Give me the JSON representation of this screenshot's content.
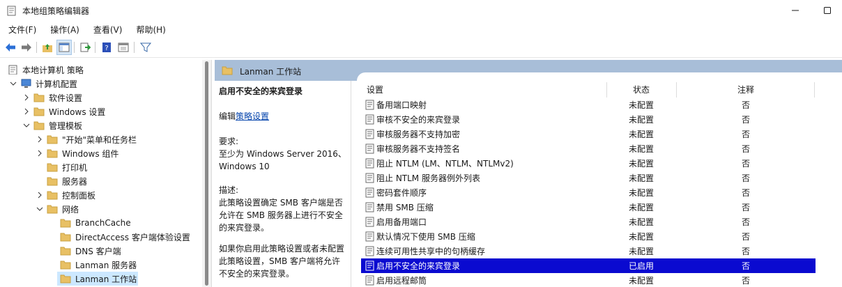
{
  "window": {
    "title": "本地组策略编辑器"
  },
  "menu": [
    "文件(F)",
    "操作(A)",
    "查看(V)",
    "帮助(H)"
  ],
  "toolbar": {
    "icons": [
      "back-icon",
      "forward-icon",
      "up-folder-icon",
      "show-hide-tree-icon",
      "export-list-icon",
      "help-icon",
      "properties-icon",
      "filter-icon"
    ]
  },
  "tree": {
    "root": "本地计算机 策略",
    "items": [
      {
        "label": "计算机配置"
      },
      {
        "label": "软件设置"
      },
      {
        "label": "Windows 设置"
      },
      {
        "label": "管理模板"
      },
      {
        "label": "\"开始\"菜单和任务栏"
      },
      {
        "label": "Windows 组件"
      },
      {
        "label": "打印机"
      },
      {
        "label": "服务器"
      },
      {
        "label": "控制面板"
      },
      {
        "label": "网络"
      },
      {
        "label": "BranchCache"
      },
      {
        "label": "DirectAccess 客户端体验设置"
      },
      {
        "label": "DNS 客户端"
      },
      {
        "label": "Lanman 服务器"
      },
      {
        "label": "Lanman 工作站"
      }
    ]
  },
  "pane": {
    "header": "Lanman 工作站",
    "description": {
      "title": "启用不安全的来宾登录",
      "edit_prefix": "编辑",
      "edit_link": "策略设置",
      "req_label": "要求:",
      "req_line1": "至少为 Windows Server 2016、",
      "req_line2": "Windows 10",
      "desc_label": "描述:",
      "desc_line1": "此策略设置确定 SMB 客户端是否",
      "desc_line2": "允许在 SMB 服务器上进行不安全",
      "desc_line3": "的来宾登录。",
      "more_line1": "如果你启用此策略设置或者未配置",
      "more_line2": "此策略设置，SMB 客户端将允许",
      "more_line3": "不安全的来宾登录。"
    },
    "columns": {
      "setting": "设置",
      "state": "状态",
      "comment": "注释"
    },
    "rows": [
      {
        "setting": "备用端口映射",
        "state": "未配置",
        "comment": "否"
      },
      {
        "setting": "审核不安全的来宾登录",
        "state": "未配置",
        "comment": "否"
      },
      {
        "setting": "审核服务器不支持加密",
        "state": "未配置",
        "comment": "否"
      },
      {
        "setting": "审核服务器不支持签名",
        "state": "未配置",
        "comment": "否"
      },
      {
        "setting": "阻止 NTLM (LM、NTLM、NTLMv2)",
        "state": "未配置",
        "comment": "否"
      },
      {
        "setting": "阻止 NTLM 服务器例外列表",
        "state": "未配置",
        "comment": "否"
      },
      {
        "setting": "密码套件顺序",
        "state": "未配置",
        "comment": "否"
      },
      {
        "setting": "禁用 SMB 压缩",
        "state": "未配置",
        "comment": "否"
      },
      {
        "setting": "启用备用端口",
        "state": "未配置",
        "comment": "否"
      },
      {
        "setting": "默认情况下使用 SMB 压缩",
        "state": "未配置",
        "comment": "否"
      },
      {
        "setting": "连续可用性共享中的句柄缓存",
        "state": "未配置",
        "comment": "否"
      },
      {
        "setting": "启用不安全的来宾登录",
        "state": "已启用",
        "comment": "否"
      },
      {
        "setting": "启用远程邮筒",
        "state": "未配置",
        "comment": "否"
      }
    ]
  },
  "colors": {
    "header": "#a8bed8",
    "selected_row": "#0a0ad0",
    "tree_selected": "#cce8ff",
    "folder": "#e8c064"
  }
}
